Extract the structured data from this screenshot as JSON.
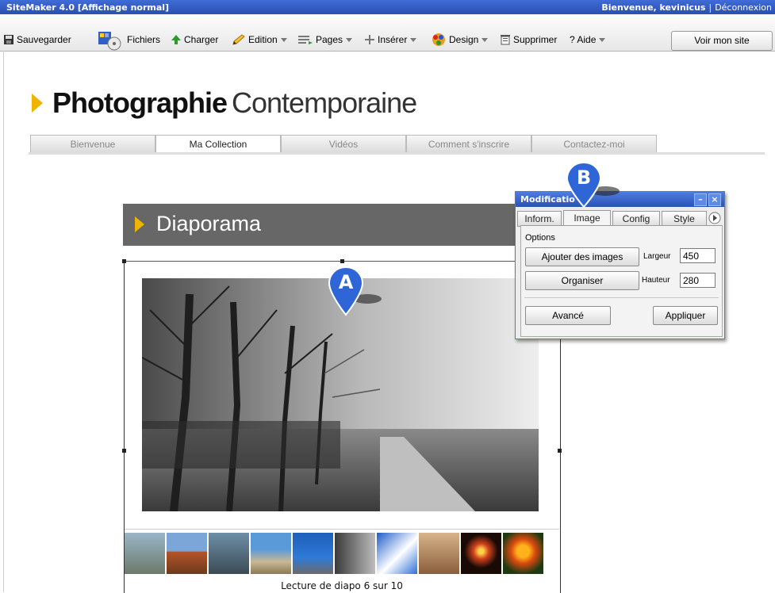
{
  "app_bar": {
    "title": "SiteMaker 4.0  [Affichage normal]",
    "welcome": "Bienvenue, kevinicus",
    "separator": "|",
    "logout": "Déconnexion"
  },
  "toolbar": {
    "save": "Sauvegarder",
    "files": "Fichiers",
    "upload": "Charger",
    "edit": "Edition",
    "pages": "Pages",
    "insert": "Insérer",
    "design": "Design",
    "delete": "Supprimer",
    "help": "? Aide",
    "view_site": "Voir mon site"
  },
  "site": {
    "logo_bold": "Photographie",
    "logo_light": "Contemporaine",
    "nav": [
      "Bienvenue",
      "Ma Collection",
      "Vidéos",
      "Comment s'inscrire",
      "Contactez-moi"
    ],
    "active_nav": "Ma Collection"
  },
  "slideshow": {
    "title": "Diaporama",
    "caption": "Lecture de diapo 6 sur 10",
    "current": 6,
    "total": 10
  },
  "markers": {
    "a": "A",
    "b": "B"
  },
  "panel": {
    "title": "Modificatio",
    "tabs": [
      "Inform.",
      "Image",
      "Config",
      "Style"
    ],
    "active_tab": "Image",
    "options_label": "Options",
    "add_images": "Ajouter des images",
    "organize": "Organiser",
    "width_label": "Largeur",
    "width_value": "450",
    "height_label": "Hauteur",
    "height_value": "280",
    "advanced": "Avancé",
    "apply": "Appliquer",
    "minimize": "–",
    "close": "×"
  },
  "colors": {
    "accent": "#f0b400",
    "titlebar": "#2b4fb0",
    "marker": "#2e66d8"
  }
}
